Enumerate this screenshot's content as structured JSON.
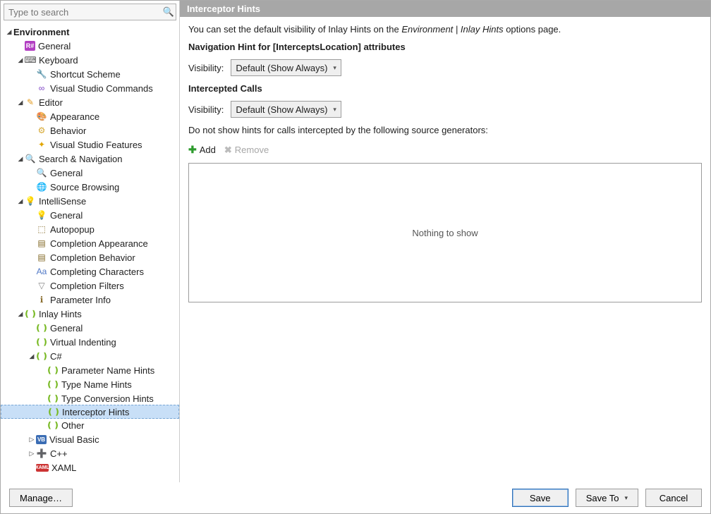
{
  "search": {
    "placeholder": "Type to search"
  },
  "tree": {
    "environment": "Environment",
    "general": "General",
    "keyboard": "Keyboard",
    "shortcut_scheme": "Shortcut Scheme",
    "vs_commands": "Visual Studio Commands",
    "editor": "Editor",
    "appearance": "Appearance",
    "behavior": "Behavior",
    "vs_features": "Visual Studio Features",
    "search_nav": "Search & Navigation",
    "sn_general": "General",
    "source_browsing": "Source Browsing",
    "intellisense": "IntelliSense",
    "is_general": "General",
    "autopopup": "Autopopup",
    "comp_appearance": "Completion Appearance",
    "comp_behavior": "Completion Behavior",
    "comp_chars": "Completing Characters",
    "comp_filters": "Completion Filters",
    "param_info": "Parameter Info",
    "inlay_hints": "Inlay Hints",
    "ih_general": "General",
    "virtual_indent": "Virtual Indenting",
    "csharp": "C#",
    "param_name_hints": "Parameter Name Hints",
    "type_name_hints": "Type Name Hints",
    "type_conv_hints": "Type Conversion Hints",
    "interceptor_hints": "Interceptor Hints",
    "other": "Other",
    "vb": "Visual Basic",
    "cpp": "C++",
    "xaml": "XAML"
  },
  "header": "Interceptor Hints",
  "desc": {
    "pre": "You can set the default visibility of Inlay Hints on the ",
    "em": "Environment | Inlay Hints",
    "post": " options page."
  },
  "section1": {
    "heading": "Navigation Hint for [InterceptsLocation] attributes",
    "vis_label": "Visibility:",
    "vis_value": "Default (Show Always)"
  },
  "section2": {
    "heading": "Intercepted Calls",
    "vis_label": "Visibility:",
    "vis_value": "Default (Show Always)",
    "note": "Do not show hints for calls intercepted by the following source generators:",
    "add": "Add",
    "remove": "Remove",
    "empty": "Nothing to show"
  },
  "footer": {
    "manage": "Manage…",
    "save": "Save",
    "save_to": "Save To",
    "cancel": "Cancel"
  }
}
